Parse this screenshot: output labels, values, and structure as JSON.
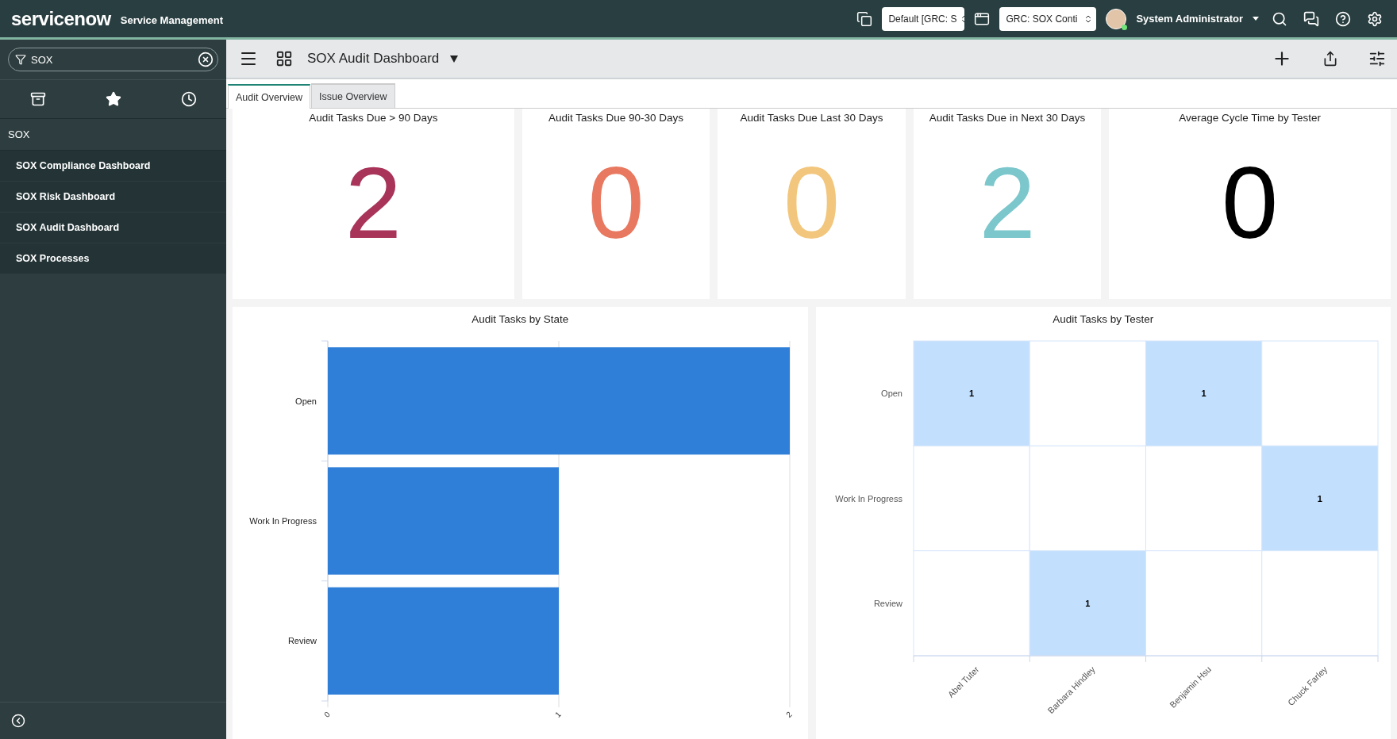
{
  "header": {
    "logo": "servicenow",
    "product": "Service Management",
    "selects": [
      {
        "value": "Default [GRC: S"
      },
      {
        "value": "GRC: SOX Conti"
      }
    ],
    "user": "System Administrator"
  },
  "sidebar": {
    "search": {
      "value": "SOX"
    },
    "tabs": [
      {
        "kind": "archive",
        "selected": false
      },
      {
        "kind": "star",
        "selected": false
      },
      {
        "kind": "history",
        "selected": false
      }
    ],
    "section": "SOX",
    "items": [
      {
        "label": "SOX Compliance Dashboard"
      },
      {
        "label": "SOX Risk Dashboard"
      },
      {
        "label": "SOX Audit Dashboard"
      },
      {
        "label": "SOX Processes"
      }
    ]
  },
  "toolbar": {
    "title": "SOX Audit Dashboard"
  },
  "tabs": [
    {
      "label": "Audit Overview",
      "selected": true
    },
    {
      "label": "Issue Overview",
      "selected": false
    }
  ],
  "scores": [
    {
      "title": "Audit Tasks Due > 90 Days",
      "value": "2",
      "color": "#a8345a"
    },
    {
      "title": "Audit Tasks Due 90-30 Days",
      "value": "0",
      "color": "#e8785f"
    },
    {
      "title": "Audit Tasks Due Last 30 Days",
      "value": "0",
      "color": "#f2c67c"
    },
    {
      "title": "Audit Tasks Due in Next 30 Days",
      "value": "2",
      "color": "#7bc7cc"
    },
    {
      "title": "Average Cycle Time by Tester",
      "value": "0",
      "color": "#000000"
    }
  ],
  "state_chart": {
    "chart_data": {
      "type": "bar",
      "orientation": "horizontal",
      "title": "Audit Tasks by State",
      "categories": [
        "Open",
        "Work In Progress",
        "Review"
      ],
      "series": [
        {
          "color": "#2f7ed8",
          "values": [
            2,
            1,
            1
          ]
        }
      ],
      "xlim": [
        0,
        2
      ],
      "xticks": [
        0,
        1,
        2
      ]
    }
  },
  "tester_chart": {
    "title": "Audit Tasks by Tester",
    "rows": [
      "Open",
      "Work In Progress",
      "Review"
    ],
    "columns": [
      "Abel Tuter",
      "Barbara Hindley",
      "Benjamin Hsu",
      "Chuck Farley"
    ],
    "cells": [
      [
        "1",
        null,
        "1",
        null
      ],
      [
        null,
        null,
        null,
        "1"
      ],
      [
        null,
        "1",
        null,
        null
      ]
    ]
  }
}
